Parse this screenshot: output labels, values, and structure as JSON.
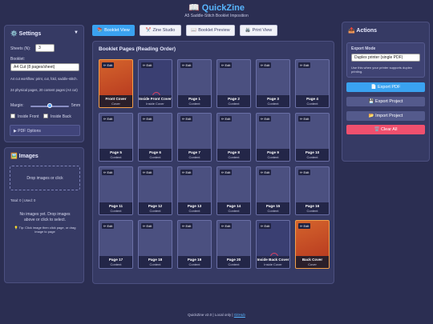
{
  "app": {
    "icon": "📖",
    "title": "QuickZine",
    "subtitle": "A5 Saddle-Stitch Booklet Imposition"
  },
  "settings": {
    "icon": "⚙️",
    "title": "Settings",
    "chevron": "▼",
    "sheets_label": "Sheets (N):",
    "sheets_value": "3",
    "booklet_label": "Booklet:",
    "booklet_value": "A4 Cut (8 pages/sheet)",
    "workflow_note": "A4 cut workflow: print, cut, fold, saddle-stitch.",
    "pages_note": "24 physical pages, 20 content pages (A4 cut)",
    "margin_label": "Margin:",
    "margin_value": "5mm",
    "margin_fraction": 0.5,
    "inside_front_label": "Inside Front",
    "inside_back_label": "Inside Back",
    "pdf_options_label": "▶ PDF Options"
  },
  "images": {
    "icon": "🖼️",
    "title": "Images",
    "drop_text": "Drop images or click",
    "counts": "Total: 0 | Used: 0",
    "empty_text": "No images yet. Drop images above or click to select.",
    "tip": "💡 Tip: Click image then click page, or drag image to page"
  },
  "tabs": [
    {
      "icon": "📚",
      "label": "Booklet View",
      "active": true
    },
    {
      "icon": "✂️",
      "label": "Zine Studio",
      "active": false
    },
    {
      "icon": "📖",
      "label": "Booklet Preview",
      "active": false
    },
    {
      "icon": "🖨️",
      "label": "Print View",
      "active": false
    }
  ],
  "booklet": {
    "title": "Booklet Pages (Reading Order)",
    "edit_label": "✏ Edit",
    "pages": [
      {
        "name": "Front Cover",
        "sub": "Cover",
        "style": "cover"
      },
      {
        "name": "Inside Front Cover",
        "sub": "Inside Cover",
        "style": "dark",
        "mark": true
      },
      {
        "name": "Page 1",
        "sub": "Content",
        "style": ""
      },
      {
        "name": "Page 2",
        "sub": "Content",
        "style": ""
      },
      {
        "name": "Page 3",
        "sub": "Content",
        "style": ""
      },
      {
        "name": "Page 4",
        "sub": "Content",
        "style": ""
      },
      {
        "name": "Page 5",
        "sub": "Content",
        "style": ""
      },
      {
        "name": "Page 6",
        "sub": "Content",
        "style": ""
      },
      {
        "name": "Page 7",
        "sub": "Content",
        "style": ""
      },
      {
        "name": "Page 8",
        "sub": "Content",
        "style": ""
      },
      {
        "name": "Page 9",
        "sub": "Content",
        "style": ""
      },
      {
        "name": "Page 10",
        "sub": "Content",
        "style": ""
      },
      {
        "name": "Page 11",
        "sub": "Content",
        "style": ""
      },
      {
        "name": "Page 12",
        "sub": "Content",
        "style": ""
      },
      {
        "name": "Page 13",
        "sub": "Content",
        "style": ""
      },
      {
        "name": "Page 14",
        "sub": "Content",
        "style": ""
      },
      {
        "name": "Page 15",
        "sub": "Content",
        "style": ""
      },
      {
        "name": "Page 16",
        "sub": "Content",
        "style": ""
      },
      {
        "name": "Page 17",
        "sub": "Content",
        "style": ""
      },
      {
        "name": "Page 18",
        "sub": "Content",
        "style": ""
      },
      {
        "name": "Page 19",
        "sub": "Content",
        "style": ""
      },
      {
        "name": "Page 20",
        "sub": "Content",
        "style": ""
      },
      {
        "name": "Inside Back Cover",
        "sub": "Inside Cover",
        "style": "dark",
        "mark": true
      },
      {
        "name": "Back Cover",
        "sub": "Cover",
        "style": "cover"
      }
    ]
  },
  "actions": {
    "icon": "📤",
    "title": "Actions",
    "export_mode_label": "Export Mode",
    "export_mode_value": "Duplex printer (single PDF)",
    "export_note": "Use this when your printer supports duplex printing.",
    "export_pdf": "📄 Export PDF",
    "export_project": "💾 Export Project",
    "import_project": "📂 Import Project",
    "clear_all": "🗑️ Clear All"
  },
  "colors": {
    "accent": "#3aa2f0",
    "danger": "#f0506e",
    "secondary": "#545a8c"
  },
  "footer": {
    "text": "QuickZine v2.0 | Local only |",
    "link": "GitHub"
  }
}
